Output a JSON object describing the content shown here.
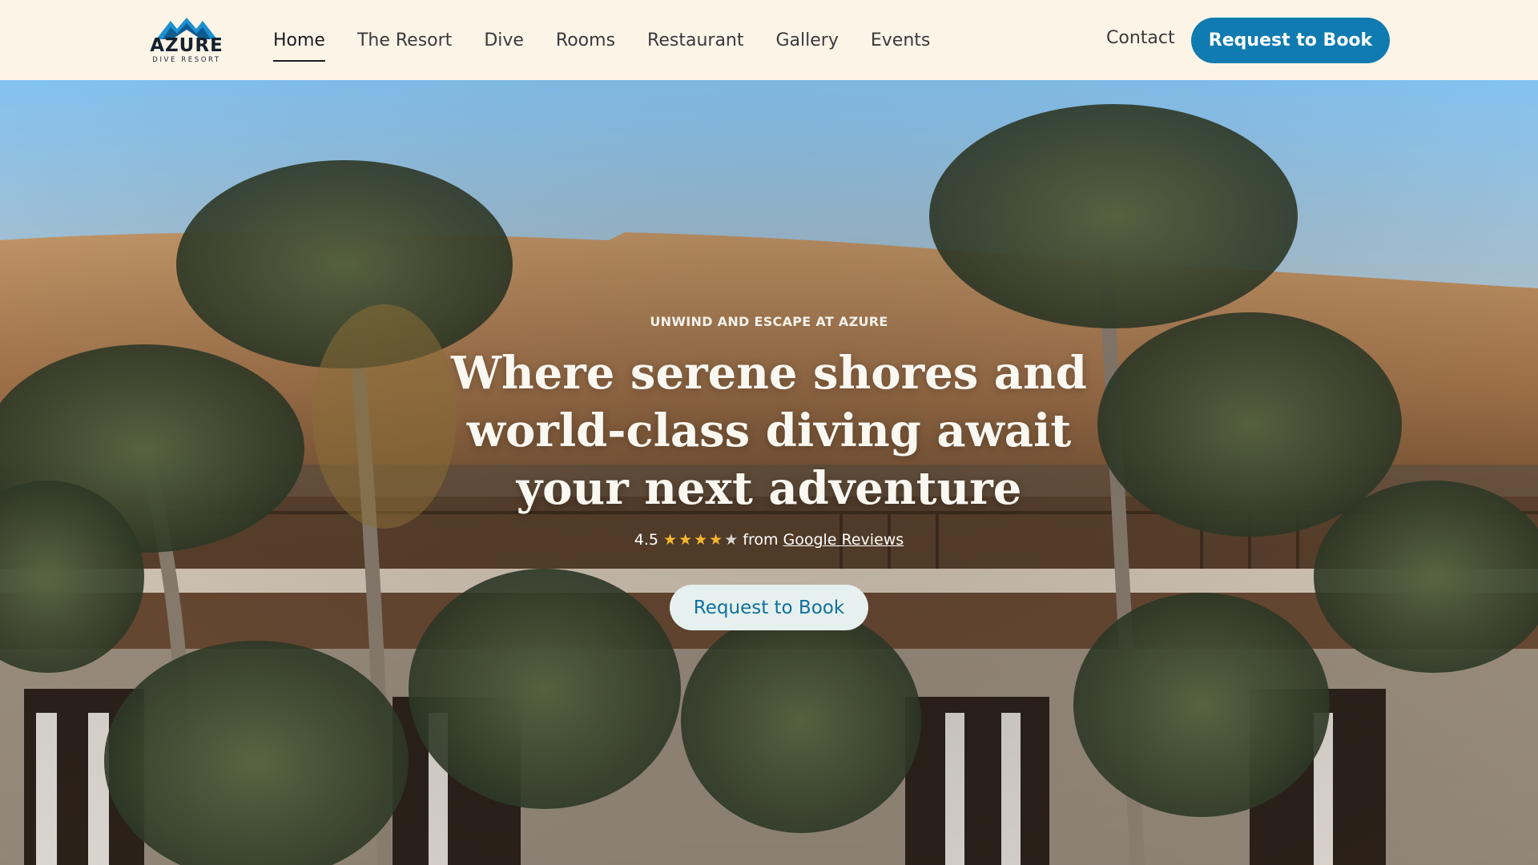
{
  "brand": {
    "name": "AZURE",
    "tagline": "DIVE RESORT"
  },
  "nav": {
    "items": [
      {
        "label": "Home",
        "active": true
      },
      {
        "label": "The Resort",
        "active": false
      },
      {
        "label": "Dive",
        "active": false
      },
      {
        "label": "Rooms",
        "active": false
      },
      {
        "label": "Restaurant",
        "active": false
      },
      {
        "label": "Gallery",
        "active": false
      },
      {
        "label": "Events",
        "active": false
      }
    ],
    "contact_label": "Contact",
    "cta_label": "Request to Book"
  },
  "hero": {
    "eyebrow": "UNWIND AND ESCAPE AT AZURE",
    "headline": "Where serene shores and world-class diving await your next adventure",
    "rating": {
      "value": "4.5",
      "stars_out_of": 5,
      "from_text": "from",
      "source_label": "Google Reviews"
    },
    "cta_label": "Request to Book"
  },
  "colors": {
    "accent": "#0f7bb0",
    "header_bg": "#fdf4e8",
    "star": "#f5b52e"
  }
}
